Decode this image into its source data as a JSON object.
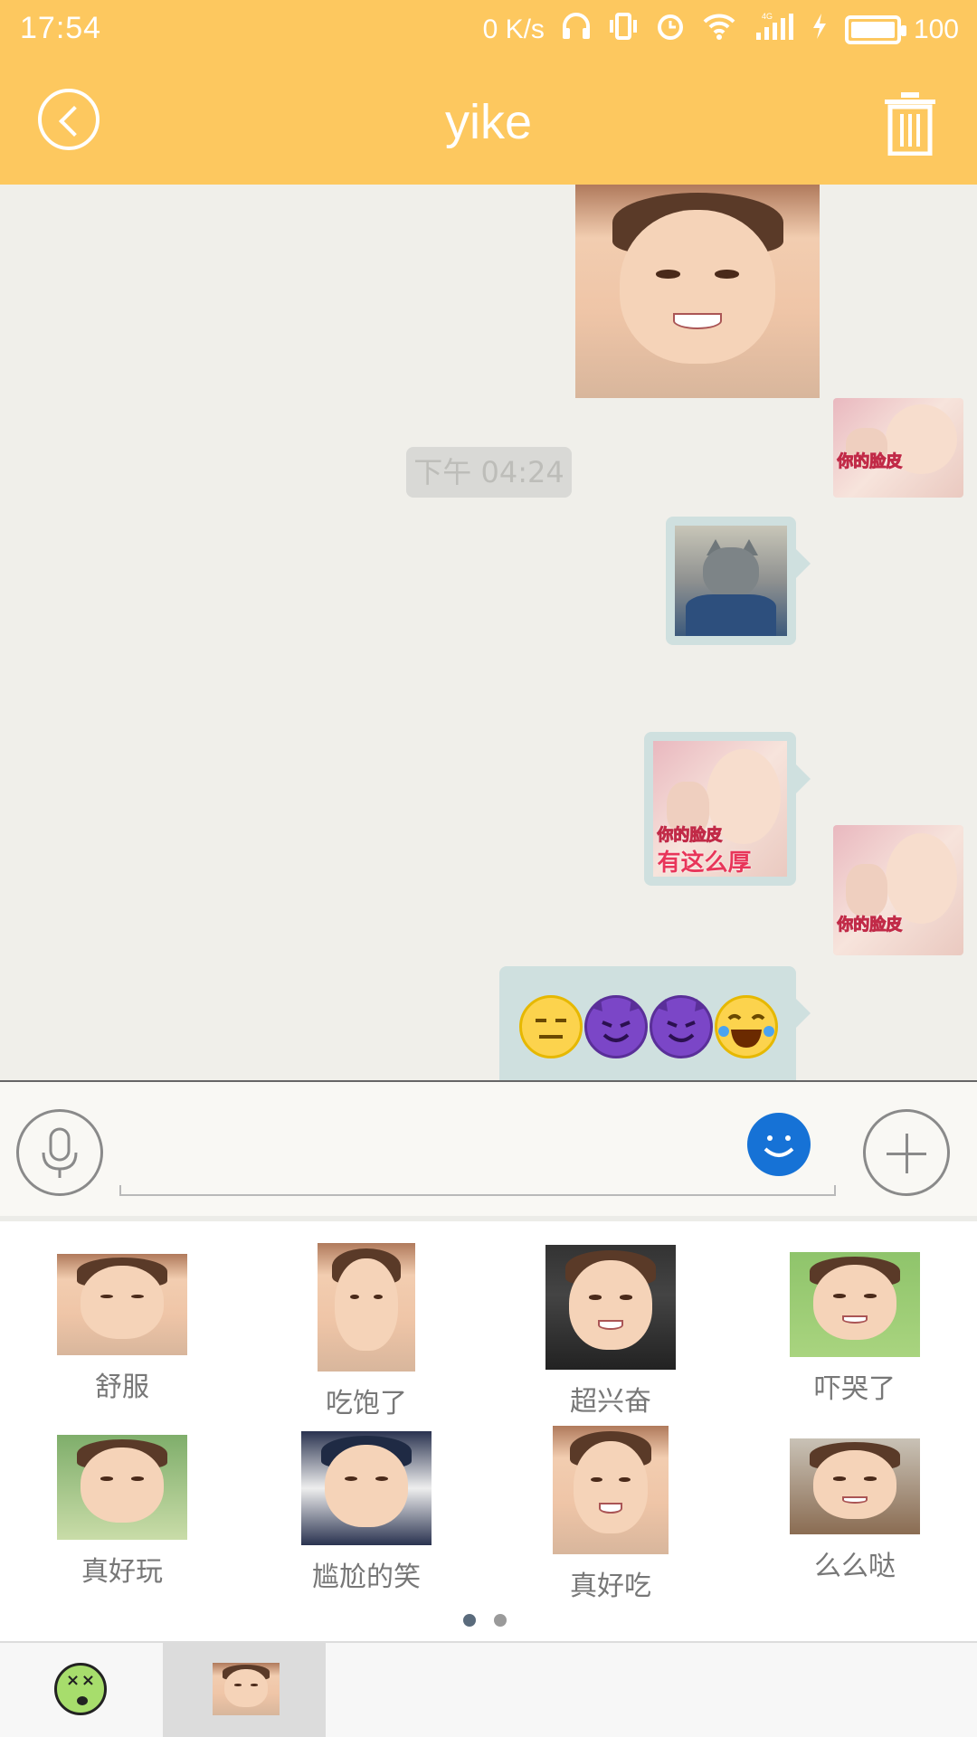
{
  "status_bar": {
    "time": "17:54",
    "net_speed": "0 K/s",
    "battery": "100",
    "icons": [
      "headphones-icon",
      "vibrate-icon",
      "alarm-icon",
      "wifi-icon",
      "signal-4g-icon",
      "charging-icon",
      "battery-icon"
    ]
  },
  "header": {
    "title": "yike",
    "back_icon": "back-icon",
    "delete_icon": "trash-icon",
    "background": "#fdc85f"
  },
  "chat": {
    "timestamp": "下午 04:24",
    "messages": [
      {
        "type": "image",
        "content": "smiling-baby-photo"
      },
      {
        "type": "image",
        "content": "cat-meme"
      },
      {
        "type": "image",
        "content": "baby-meme",
        "caption_line1": "你的脸皮",
        "caption_line2": "有这么厚"
      },
      {
        "type": "emoji",
        "content": [
          "expressionless-face",
          "smiling-devil",
          "smiling-devil",
          "tears-of-joy"
        ]
      }
    ],
    "avatar_caption": "你的脸皮",
    "bubble_color": "#cfe0df"
  },
  "input_bar": {
    "placeholder": "",
    "value": "",
    "mic_icon": "mic-icon",
    "emoji_icon": "smiley-icon",
    "add_icon": "plus-icon",
    "accent": "#1672d6"
  },
  "stickers": [
    {
      "label": "舒服"
    },
    {
      "label": "吃饱了"
    },
    {
      "label": "超兴奋"
    },
    {
      "label": "吓哭了"
    },
    {
      "label": "真好玩"
    },
    {
      "label": "尴尬的笑"
    },
    {
      "label": "真好吃"
    },
    {
      "label": "么么哒"
    }
  ],
  "pager": {
    "pages": 2,
    "current": 1
  },
  "bottom_tabs": [
    {
      "icon": "zombie-face-icon",
      "selected": false
    },
    {
      "icon": "baby-sticker-pack-icon",
      "selected": true
    }
  ]
}
